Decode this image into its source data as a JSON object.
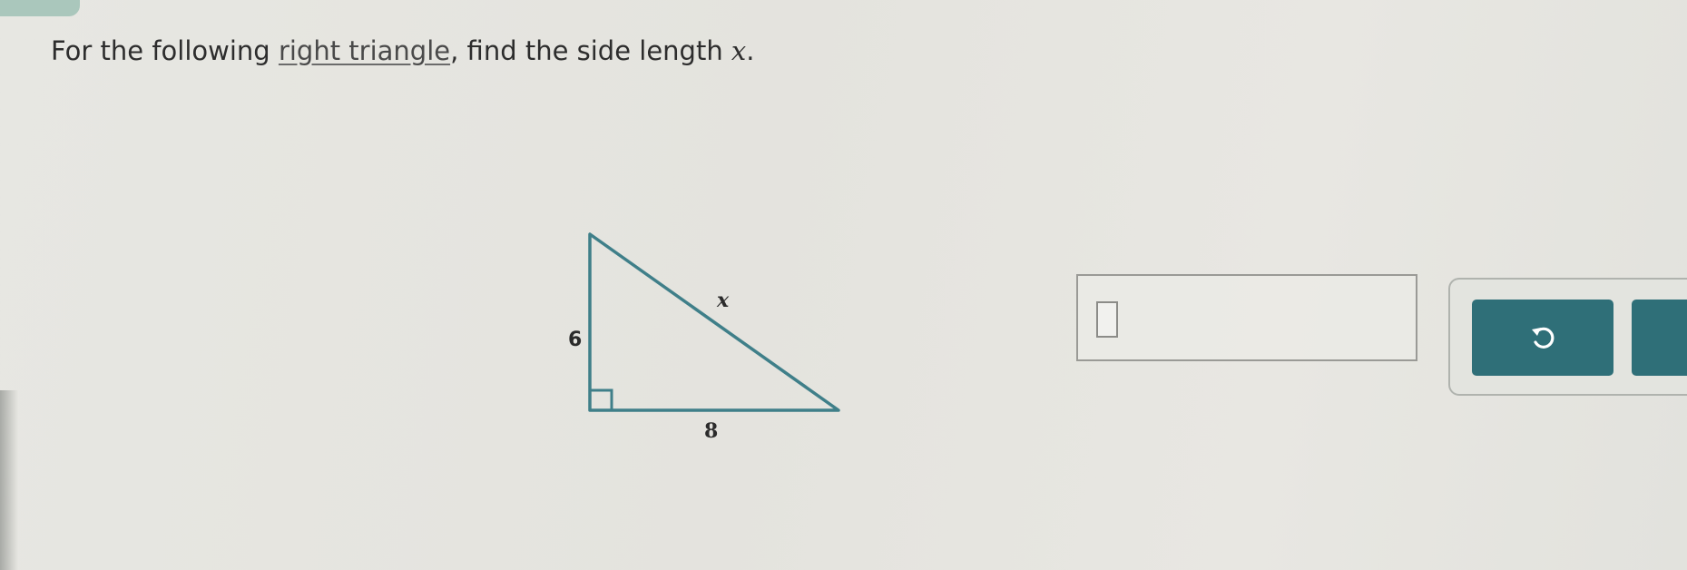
{
  "question": {
    "prefix": "For the following ",
    "link_text": "right triangle",
    "middle": ", find the side length ",
    "variable": "x",
    "suffix": "."
  },
  "figure": {
    "hypotenuse_label": "x",
    "vertical_leg_label": "6",
    "horizontal_leg_label": "8"
  },
  "answer": {
    "value": ""
  },
  "tools": {
    "undo_icon": "undo-icon",
    "accent_color": "#2f6f78"
  }
}
